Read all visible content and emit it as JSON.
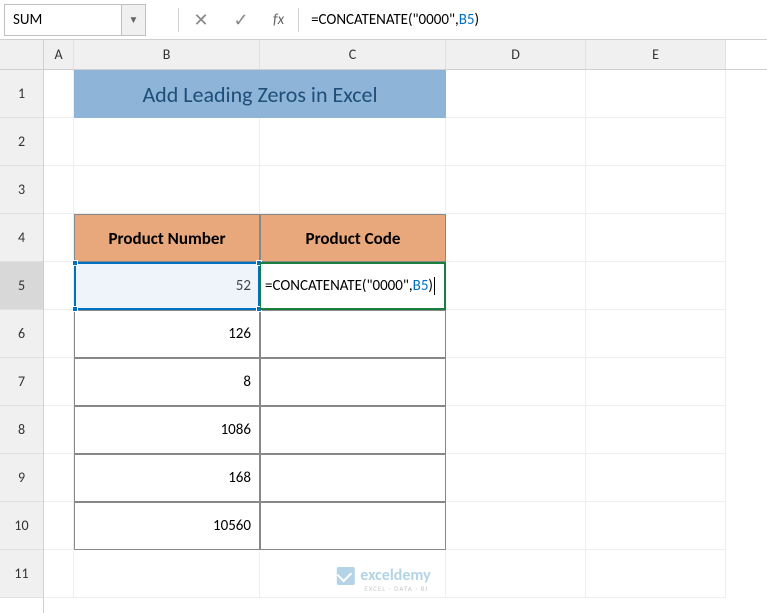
{
  "nameBox": "SUM",
  "formula": {
    "prefix": "=CONCATENATE(\"0000\",",
    "ref": "B5",
    "suffix": ")"
  },
  "colHeaders": {
    "A": "A",
    "B": "B",
    "C": "C",
    "D": "D",
    "E": "E"
  },
  "rowHeaders": [
    "1",
    "2",
    "3",
    "4",
    "5",
    "6",
    "7",
    "8",
    "9",
    "10",
    "11"
  ],
  "title": "Add Leading Zeros in Excel",
  "table": {
    "headers": {
      "B": "Product Number",
      "C": "Product Code"
    },
    "rows": [
      {
        "B": "52",
        "C_formula_prefix": "=CONCATENATE(\"0000\",",
        "C_formula_ref": "B5",
        "C_formula_suffix": ")"
      },
      {
        "B": "126",
        "C": ""
      },
      {
        "B": "8",
        "C": ""
      },
      {
        "B": "1086",
        "C": ""
      },
      {
        "B": "168",
        "C": ""
      },
      {
        "B": "10560",
        "C": ""
      }
    ]
  },
  "watermark": {
    "brand": "exceldemy",
    "sub": "EXCEL · DATA · BI"
  },
  "chart_data": null
}
